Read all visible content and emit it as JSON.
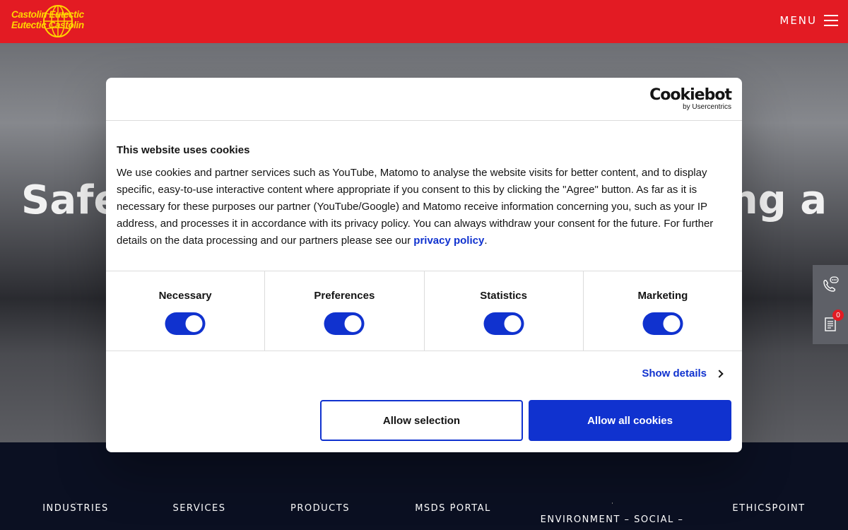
{
  "header": {
    "logo": {
      "line1": "Castolin Eutectic",
      "line2": "Eutectic Castolin"
    },
    "menu_label": "MENU"
  },
  "hero": {
    "title_left": "Safe",
    "title_right": "ing a"
  },
  "side_tools": {
    "cart_count": "0"
  },
  "footer": {
    "items": [
      "INDUSTRIES",
      "SERVICES",
      "PRODUCTS",
      "MSDS PORTAL",
      "ENVIRONMENT – SOCIAL –",
      "ETHICSPOINT"
    ]
  },
  "cookie_dialog": {
    "brand": "Cookiebot",
    "brand_sub": "by Usercentrics",
    "title": "This website uses cookies",
    "body": "We use cookies and partner services such as YouTube, Matomo to analyse the website visits for better content, and to display specific, easy-to-use interactive content where appropriate if you consent to this by clicking the \"Agree\" button. As far as it is necessary for these purposes our partner (YouTube/Google) and Matomo receive information concerning you, such as your IP address, and processes it in accordance with its privacy policy. You can always withdraw your consent for the future. For further details on the data processing and our partners please see our",
    "privacy_link": "privacy policy",
    "body_end": ".",
    "categories": [
      {
        "label": "Necessary",
        "enabled": true
      },
      {
        "label": "Preferences",
        "enabled": true
      },
      {
        "label": "Statistics",
        "enabled": true
      },
      {
        "label": "Marketing",
        "enabled": true
      }
    ],
    "show_details": "Show details",
    "allow_selection": "Allow selection",
    "allow_all": "Allow all cookies"
  },
  "colors": {
    "brand_red": "#e31b23",
    "logo_yellow": "#ffd400",
    "cookiebot_blue": "#1032cf",
    "footer_navy": "#0b1022"
  }
}
